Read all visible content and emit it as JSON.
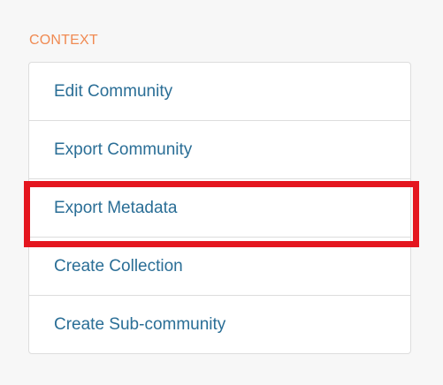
{
  "context_menu": {
    "heading": "CONTEXT",
    "items": [
      {
        "label": "Edit Community"
      },
      {
        "label": "Export Community"
      },
      {
        "label": "Export Metadata"
      },
      {
        "label": "Create Collection"
      },
      {
        "label": "Create Sub-community"
      }
    ]
  },
  "colors": {
    "heading": "#f08a52",
    "link": "#2a6e96",
    "highlight": "#e4161f",
    "panel_background": "#f7f7f7",
    "border": "#dddddd"
  },
  "highlight": {
    "target_item": "Export Metadata"
  }
}
